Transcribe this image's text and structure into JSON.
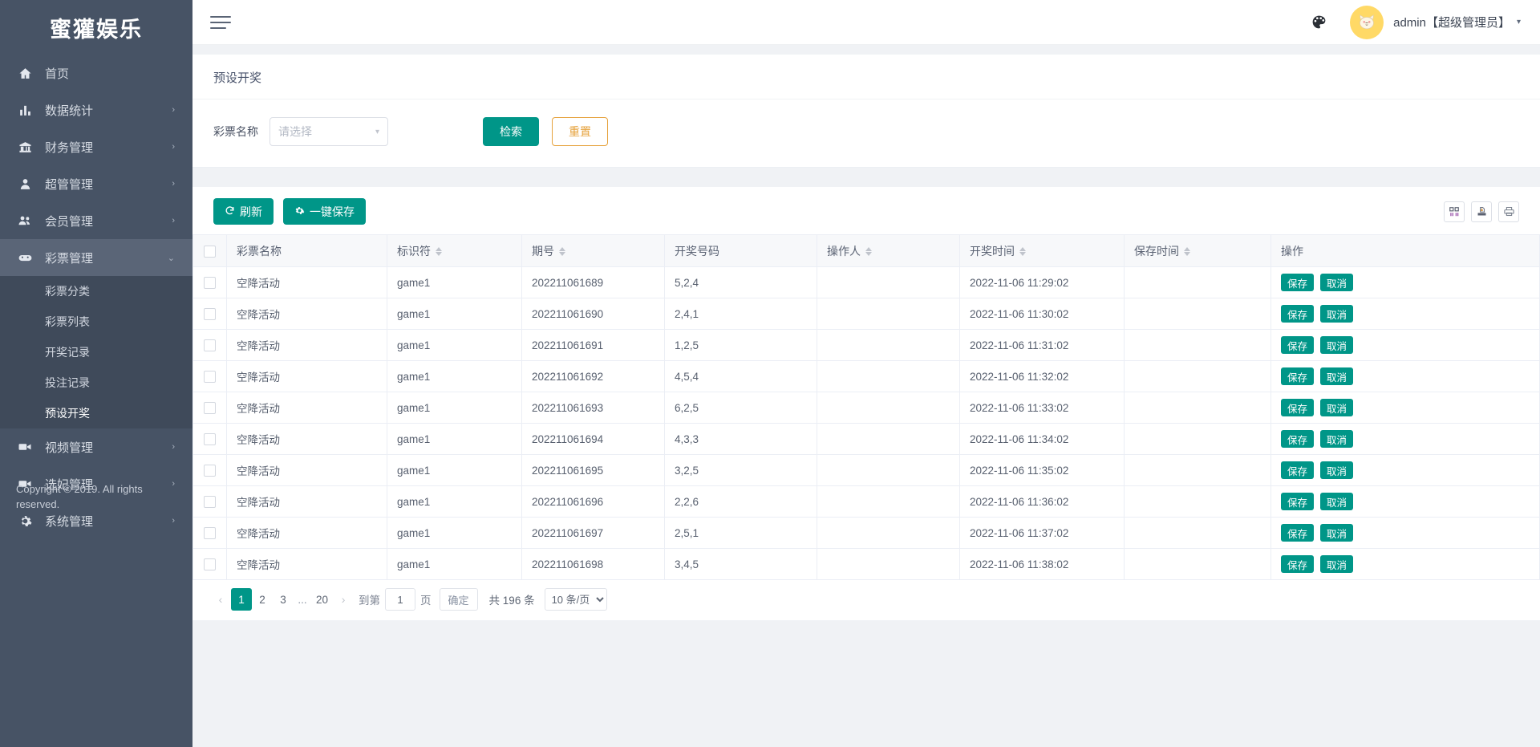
{
  "sidebar": {
    "brand": "蜜獾娱乐",
    "items": [
      {
        "label": "首页",
        "icon": "home-icon",
        "arrow": ""
      },
      {
        "label": "数据统计",
        "icon": "chart-bar-icon",
        "arrow": "›"
      },
      {
        "label": "财务管理",
        "icon": "bank-icon",
        "arrow": "›"
      },
      {
        "label": "超管管理",
        "icon": "user-icon",
        "arrow": "›"
      },
      {
        "label": "会员管理",
        "icon": "users-icon",
        "arrow": "›"
      },
      {
        "label": "彩票管理",
        "icon": "gamepad-icon",
        "arrow": "⌄",
        "active": true
      },
      {
        "label": "视频管理",
        "icon": "video-icon",
        "arrow": "›"
      },
      {
        "label": "选妃管理",
        "icon": "video-icon",
        "arrow": "›"
      },
      {
        "label": "系统管理",
        "icon": "gear-icon",
        "arrow": "›"
      }
    ],
    "submenu": [
      {
        "label": "彩票分类"
      },
      {
        "label": "彩票列表"
      },
      {
        "label": "开奖记录"
      },
      {
        "label": "投注记录"
      },
      {
        "label": "预设开奖",
        "active": true
      }
    ],
    "copyright": "Copyright © 2019. All rights reserved."
  },
  "topbar": {
    "menu_toggle": "hamburger-icon",
    "theme_icon": "palette-icon",
    "avatar_icon": "cat-avatar",
    "user_name": "admin【超级管理员】",
    "caret": "▾"
  },
  "page": {
    "title": "预设开奖",
    "filter": {
      "label": "彩票名称",
      "select_placeholder": "请选择",
      "search_label": "检索",
      "reset_label": "重置"
    },
    "toolbar": {
      "refresh_label": "刷新",
      "save_all_label": "一键保存",
      "icons": [
        "columns-icon",
        "export-icon",
        "print-icon"
      ]
    }
  },
  "table": {
    "columns": [
      {
        "key": "name",
        "label": "彩票名称",
        "sortable": false
      },
      {
        "key": "ident",
        "label": "标识符",
        "sortable": true
      },
      {
        "key": "period",
        "label": "期号",
        "sortable": true
      },
      {
        "key": "numbers",
        "label": "开奖号码",
        "sortable": false
      },
      {
        "key": "operator",
        "label": "操作人",
        "sortable": true
      },
      {
        "key": "draw_time",
        "label": "开奖时间",
        "sortable": true
      },
      {
        "key": "save_time",
        "label": "保存时间",
        "sortable": true
      },
      {
        "key": "actions",
        "label": "操作",
        "sortable": false
      }
    ],
    "row_actions": {
      "save": "保存",
      "cancel": "取消"
    },
    "rows": [
      {
        "name": "空降活动",
        "ident": "game1",
        "period": "202211061689",
        "numbers": "5,2,4",
        "operator": "",
        "draw_time": "2022-11-06 11:29:02",
        "save_time": ""
      },
      {
        "name": "空降活动",
        "ident": "game1",
        "period": "202211061690",
        "numbers": "2,4,1",
        "operator": "",
        "draw_time": "2022-11-06 11:30:02",
        "save_time": ""
      },
      {
        "name": "空降活动",
        "ident": "game1",
        "period": "202211061691",
        "numbers": "1,2,5",
        "operator": "",
        "draw_time": "2022-11-06 11:31:02",
        "save_time": ""
      },
      {
        "name": "空降活动",
        "ident": "game1",
        "period": "202211061692",
        "numbers": "4,5,4",
        "operator": "",
        "draw_time": "2022-11-06 11:32:02",
        "save_time": ""
      },
      {
        "name": "空降活动",
        "ident": "game1",
        "period": "202211061693",
        "numbers": "6,2,5",
        "operator": "",
        "draw_time": "2022-11-06 11:33:02",
        "save_time": ""
      },
      {
        "name": "空降活动",
        "ident": "game1",
        "period": "202211061694",
        "numbers": "4,3,3",
        "operator": "",
        "draw_time": "2022-11-06 11:34:02",
        "save_time": ""
      },
      {
        "name": "空降活动",
        "ident": "game1",
        "period": "202211061695",
        "numbers": "3,2,5",
        "operator": "",
        "draw_time": "2022-11-06 11:35:02",
        "save_time": ""
      },
      {
        "name": "空降活动",
        "ident": "game1",
        "period": "202211061696",
        "numbers": "2,2,6",
        "operator": "",
        "draw_time": "2022-11-06 11:36:02",
        "save_time": ""
      },
      {
        "name": "空降活动",
        "ident": "game1",
        "period": "202211061697",
        "numbers": "2,5,1",
        "operator": "",
        "draw_time": "2022-11-06 11:37:02",
        "save_time": ""
      },
      {
        "name": "空降活动",
        "ident": "game1",
        "period": "202211061698",
        "numbers": "3,4,5",
        "operator": "",
        "draw_time": "2022-11-06 11:38:02",
        "save_time": ""
      }
    ]
  },
  "pagination": {
    "prev": "‹",
    "next": "›",
    "pages": [
      "1",
      "2",
      "3"
    ],
    "ellipsis": "...",
    "last_page": "20",
    "current": "1",
    "goto_prefix": "到第",
    "goto_value": "1",
    "goto_suffix": "页",
    "confirm": "确定",
    "total": "共 196 条",
    "page_size": "10 条/页"
  },
  "colors": {
    "sidebar_bg": "#475365",
    "accent_teal": "#009688",
    "warn_amber": "#e6a23c",
    "number_red": "#f23030",
    "avatar_yellow": "#ffd966"
  }
}
